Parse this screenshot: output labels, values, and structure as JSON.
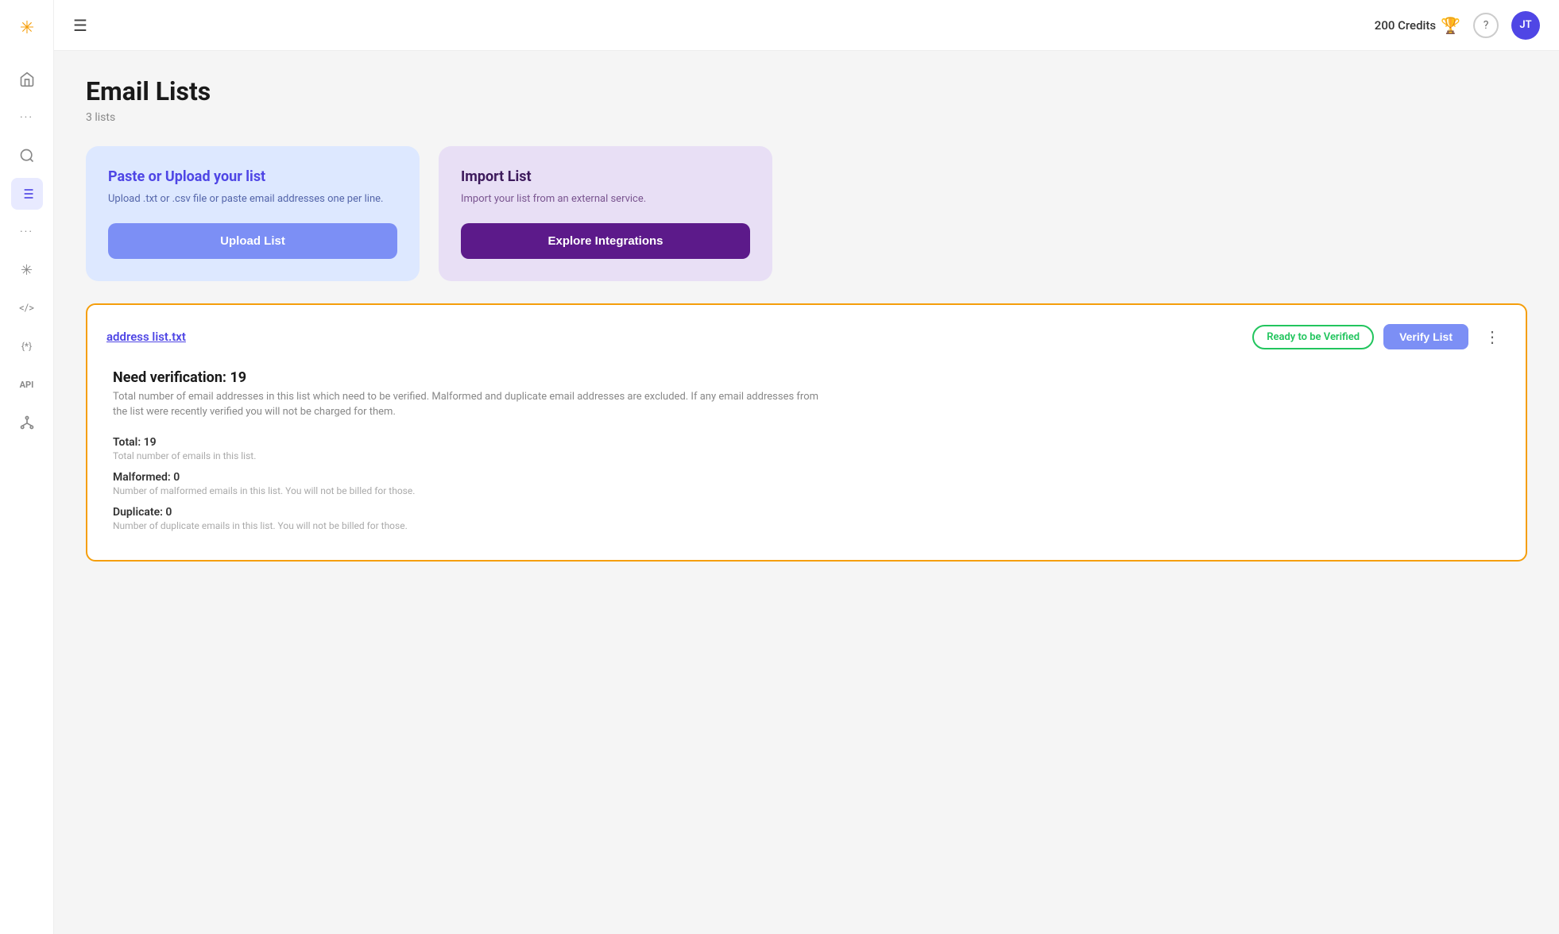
{
  "sidebar": {
    "logo": "✳",
    "items": [
      {
        "id": "home",
        "icon": "⌂",
        "active": false
      },
      {
        "id": "dots1",
        "icon": "···",
        "active": false
      },
      {
        "id": "search",
        "icon": "◎",
        "active": false
      },
      {
        "id": "lists",
        "icon": "≡",
        "active": true
      },
      {
        "id": "dots2",
        "icon": "···",
        "active": false
      },
      {
        "id": "asterisk",
        "icon": "✳",
        "active": false
      },
      {
        "id": "code",
        "icon": "</>",
        "active": false
      },
      {
        "id": "regex",
        "icon": "{*}",
        "active": false
      },
      {
        "id": "api",
        "icon": "API",
        "active": false
      },
      {
        "id": "integrations",
        "icon": "⌘",
        "active": false
      }
    ]
  },
  "header": {
    "hamburger_label": "☰",
    "credits": "200 Credits",
    "help_label": "?",
    "avatar_label": "JT"
  },
  "page": {
    "title": "Email Lists",
    "subtitle": "3 lists"
  },
  "upload_card": {
    "title": "Paste or Upload your list",
    "description": "Upload .txt or .csv file or paste email addresses one per line.",
    "button_label": "Upload List"
  },
  "import_card": {
    "title": "Import List",
    "description": "Import your list from an external service.",
    "button_label": "Explore Integrations"
  },
  "list_item": {
    "filename": "address list.txt",
    "status_label": "Ready to be Verified",
    "verify_button_label": "Verify List",
    "more_button_label": "⋮",
    "need_verification_label": "Need verification: 19",
    "need_verification_desc": "Total number of email addresses in this list which need to be verified. Malformed and duplicate email addresses are excluded. If any email addresses from the list were recently verified you will not be charged for them.",
    "total_label": "Total: 19",
    "total_desc": "Total number of emails in this list.",
    "malformed_label": "Malformed: 0",
    "malformed_desc": "Number of malformed emails in this list. You will not be billed for those.",
    "duplicate_label": "Duplicate: 0",
    "duplicate_desc": "Number of duplicate emails in this list. You will not be billed for those."
  },
  "colors": {
    "accent": "#f59e0b",
    "primary": "#4f46e5",
    "upload_card_bg": "#dde8ff",
    "import_card_bg": "#e8dff5",
    "verify_btn_bg": "#7c8ff5",
    "import_btn_bg": "#5c1a8a",
    "ready_badge_color": "#22c55e",
    "list_border": "#f59e0b"
  }
}
